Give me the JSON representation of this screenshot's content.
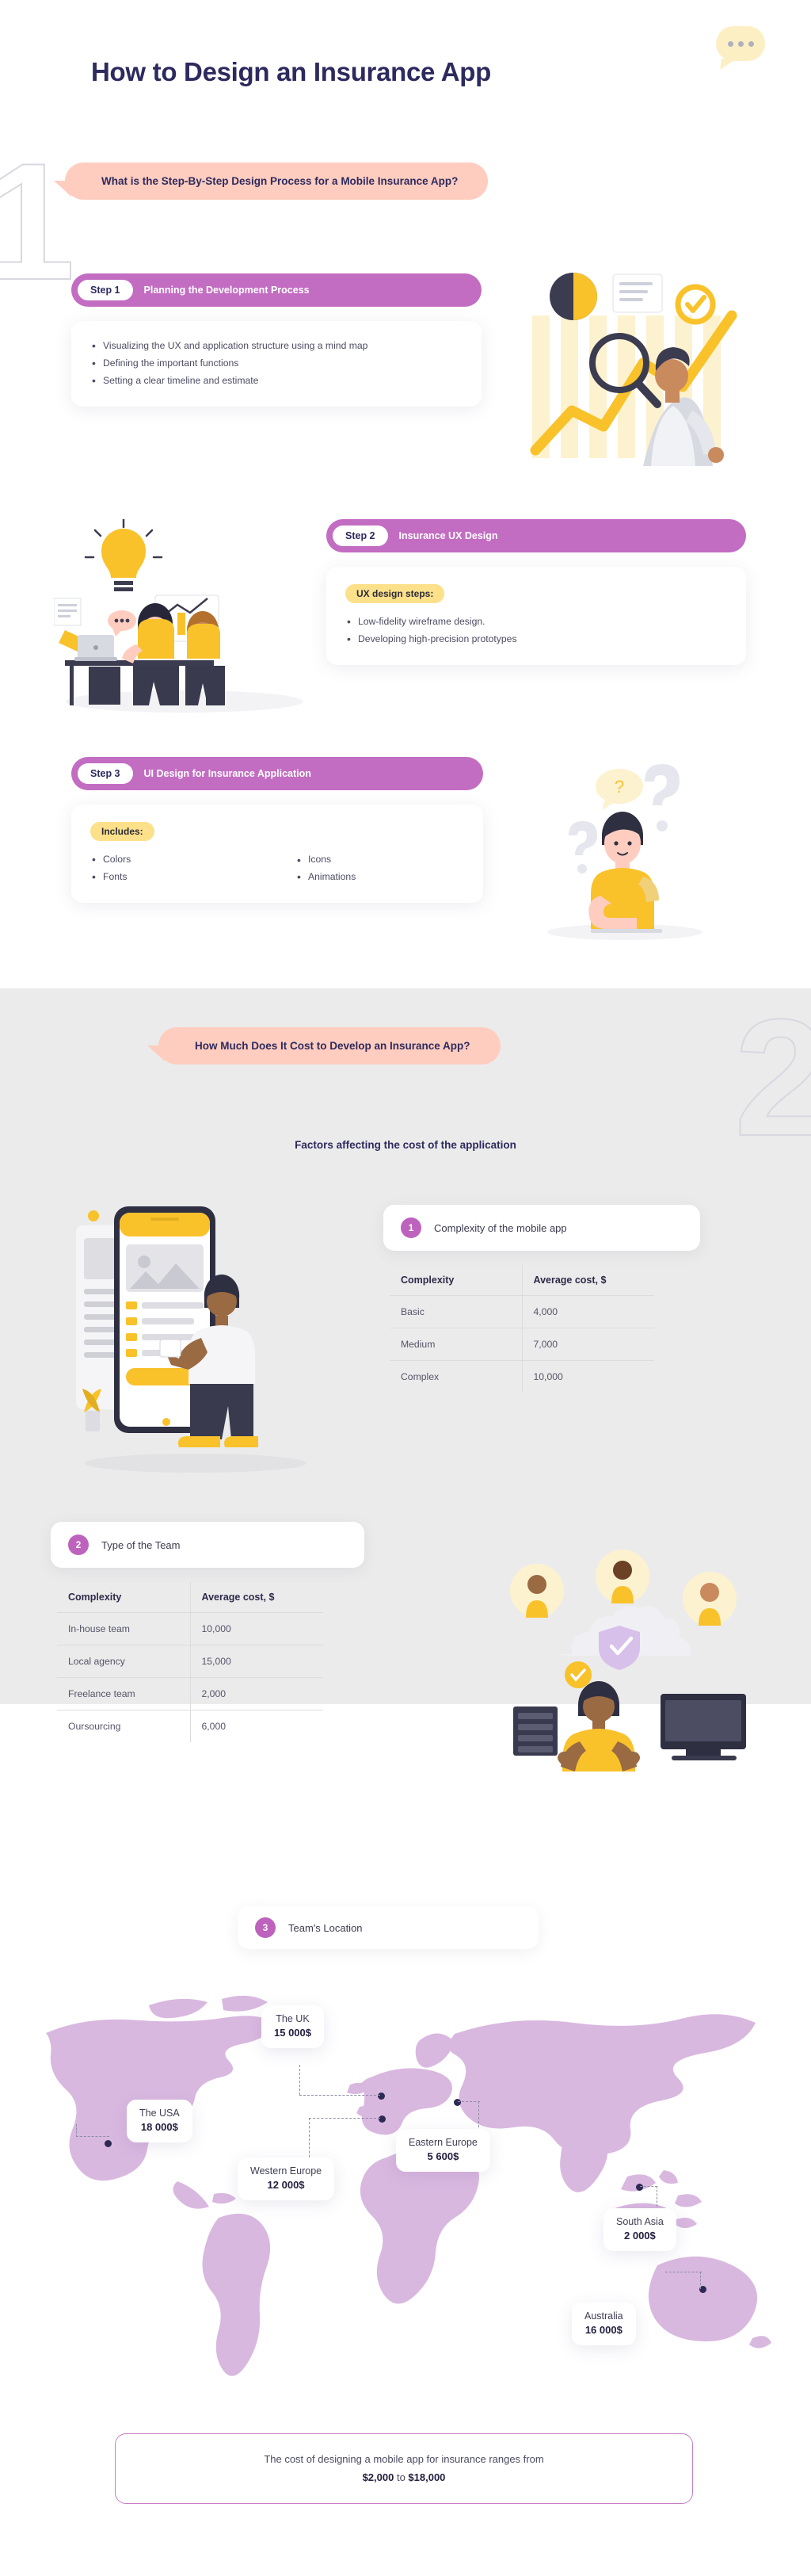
{
  "header": {
    "title": "How to Design an Insurance App",
    "bubble_icon": "chat-dots-icon"
  },
  "ghost_numerals": {
    "one": "1",
    "two": "2"
  },
  "section1": {
    "question": "What is the Step-By-Step Design Process for a Mobile Insurance App?",
    "steps": [
      {
        "badge": "Step 1",
        "title": "Planning the Development Process",
        "tag": "",
        "bullets": [
          "Visualizing the UX and application structure using a mind map",
          "Defining the important functions",
          "Setting a clear timeline and estimate"
        ]
      },
      {
        "badge": "Step 2",
        "title": "Insurance UX Design",
        "tag": "UX design steps:",
        "bullets": [
          "Low-fidelity wireframe design.",
          "Developing high-precision prototypes"
        ]
      },
      {
        "badge": "Step 3",
        "title": "UI Design for Insurance Application",
        "tag": "Includes:",
        "bullets": [
          "Colors",
          "Fonts",
          "Icons",
          "Animations"
        ]
      }
    ]
  },
  "section2": {
    "question": "How Much Does It Cost to Develop an Insurance App?",
    "subtitle": "Factors affecting the cost of the application",
    "factors": [
      {
        "number": "1",
        "label": "Complexity of the mobile app",
        "columns": [
          "Complexity",
          "Average cost, $"
        ],
        "rows": [
          [
            "Basic",
            "4,000"
          ],
          [
            "Medium",
            "7,000"
          ],
          [
            "Complex",
            "10,000"
          ]
        ]
      },
      {
        "number": "2",
        "label": "Type of the Team",
        "columns": [
          "Complexity",
          "Average cost, $"
        ],
        "rows": [
          [
            "In-house team",
            "10,000"
          ],
          [
            "Local agency",
            "15,000"
          ],
          [
            "Freelance team",
            "2,000"
          ],
          [
            "Oursourcing",
            "6,000"
          ]
        ]
      }
    ]
  },
  "section3": {
    "number": "3",
    "label": "Team's Location",
    "locations": [
      {
        "name": "The UK",
        "cost": "15 000$"
      },
      {
        "name": "The USA",
        "cost": "18 000$"
      },
      {
        "name": "Western Europe",
        "cost": "12 000$"
      },
      {
        "name": "Eastern Europe",
        "cost": "5 600$"
      },
      {
        "name": "South Asia",
        "cost": "2 000$"
      },
      {
        "name": "Australia",
        "cost": "16 000$"
      }
    ]
  },
  "summary": {
    "line1": "The cost of designing a mobile app for insurance ranges from",
    "amount_low": "$2,000",
    "amount_join": " to ",
    "amount_high": "$18,000"
  },
  "colors": {
    "brand_purple": "#c26dc2",
    "navy": "#2d2a5e",
    "pink_banner": "#ffcdbf",
    "yellow_tag": "#fde08a",
    "gray_section": "#ebebeb",
    "map_land": "#d9b8e0"
  },
  "chart_data": {
    "type": "table",
    "title": "Factors affecting the cost of the application",
    "tables": [
      {
        "name": "Complexity of the mobile app",
        "columns": [
          "Complexity",
          "Average cost, $"
        ],
        "categories": [
          "Basic",
          "Medium",
          "Complex"
        ],
        "values": [
          4000,
          7000,
          10000
        ]
      },
      {
        "name": "Type of the Team",
        "columns": [
          "Complexity",
          "Average cost, $"
        ],
        "categories": [
          "In-house team",
          "Local agency",
          "Freelance team",
          "Oursourcing"
        ],
        "values": [
          10000,
          15000,
          2000,
          6000
        ]
      },
      {
        "name": "Team's Location",
        "columns": [
          "Location",
          "Average cost, $"
        ],
        "categories": [
          "The UK",
          "The USA",
          "Western Europe",
          "Eastern Europe",
          "South Asia",
          "Australia"
        ],
        "values": [
          15000,
          18000,
          12000,
          5600,
          2000,
          16000
        ]
      }
    ]
  }
}
